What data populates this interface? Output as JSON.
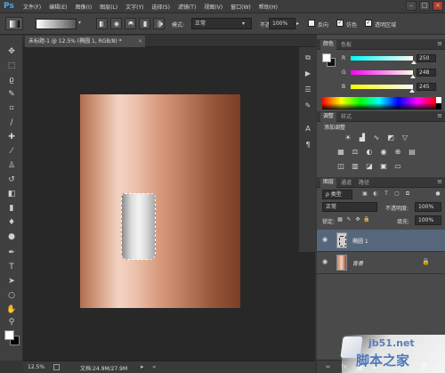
{
  "app": {
    "logo": "Ps"
  },
  "menu": [
    "文件(F)",
    "编辑(E)",
    "图像(I)",
    "图层(L)",
    "文字(Y)",
    "选择(S)",
    "滤镜(T)",
    "视图(V)",
    "窗口(W)",
    "帮助(H)"
  ],
  "window_controls": {
    "minimize": "–",
    "restore": "□",
    "close": "×"
  },
  "options_bar": {
    "mode_label": "模式:",
    "mode_value": "正常",
    "opacity_label": "不透明度:",
    "opacity_value": "100%",
    "reverse_label": "反向",
    "dither_label": "仿色",
    "transparency_label": "透明区域",
    "reverse_checked": false,
    "dither_checked": true,
    "transparency_checked": true
  },
  "document": {
    "tab_title": "未标题-1 @ 12.5% (椭圆 1, RGB/8) *",
    "tab_close": "×",
    "canvas_gradient_colors": [
      "#b26e4f",
      "#f3d3c4",
      "#7b3e25"
    ]
  },
  "status_bar": {
    "zoom": "12.5%",
    "doc_size": "文档:24.9M/27.9M"
  },
  "color_panel": {
    "tabs": [
      "颜色",
      "色板"
    ],
    "active_tab": 0,
    "r_label": "R",
    "g_label": "G",
    "b_label": "B",
    "r_value": "250",
    "g_value": "248",
    "b_value": "245"
  },
  "adjust_panel": {
    "tabs": [
      "调整",
      "样式"
    ],
    "active_tab": 0,
    "title": "添加调整"
  },
  "layers_panel": {
    "tabs": [
      "图层",
      "通道",
      "路径"
    ],
    "active_tab": 0,
    "kind_filter": "ρ 类型",
    "blend_mode": "正常",
    "opacity_label": "不透明度:",
    "opacity_value": "100%",
    "lock_label": "锁定:",
    "fill_label": "填充:",
    "fill_value": "100%",
    "layers": [
      {
        "name": "椭圆 1",
        "selected": true
      },
      {
        "name": "背景",
        "selected": false,
        "locked": true
      }
    ]
  },
  "watermark": {
    "line1": "jb51.net",
    "line2": "脚本之家"
  },
  "icons": {
    "toolbox": [
      "move-icon",
      "marquee-icon",
      "lasso-icon",
      "quick-select-icon",
      "crop-icon",
      "eyedropper-icon",
      "healing-brush-icon",
      "brush-icon",
      "clone-stamp-icon",
      "history-brush-icon",
      "eraser-icon",
      "gradient-icon",
      "blur-icon",
      "dodge-icon",
      "pen-icon",
      "type-icon",
      "path-select-icon",
      "shape-icon",
      "hand-icon",
      "zoom-icon"
    ],
    "strip": [
      "history-icon",
      "actions-icon",
      "properties-icon",
      "brush-presets-icon",
      "char-icon",
      "para-icon"
    ]
  }
}
